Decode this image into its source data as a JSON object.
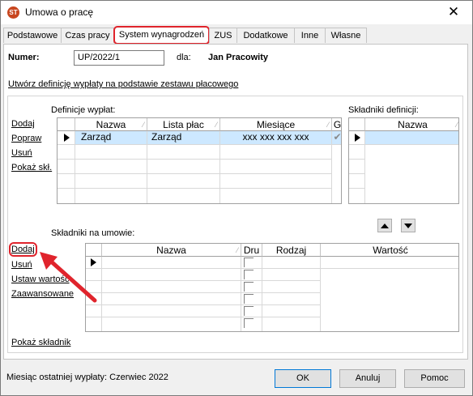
{
  "window": {
    "title": "Umowa o pracę",
    "close_glyph": "✕",
    "icon_text": "ST"
  },
  "tabs": [
    {
      "label": "Podstawowe"
    },
    {
      "label": "Czas pracy"
    },
    {
      "label": "System wynagrodzeń",
      "active": true
    },
    {
      "label": "ZUS"
    },
    {
      "label": "Dodatkowe"
    },
    {
      "label": "Inne"
    },
    {
      "label": "Własne"
    }
  ],
  "header": {
    "numer_label": "Numer:",
    "numer_value": "UP/2022/1",
    "dla_label": "dla:",
    "employee": "Jan Pracowity"
  },
  "create_link": "Utwórz definicję wypłaty na podstawie zestawu płacowego",
  "definitions": {
    "section_label": "Definicje wypłat:",
    "actions": [
      "Dodaj",
      "Popraw",
      "Usuń",
      "Pokaż skł."
    ],
    "columns": [
      "Nazwa",
      "Lista płac",
      "Miesiące",
      "G"
    ],
    "rows": [
      {
        "nazwa": "Zarząd",
        "lista": "Zarząd",
        "miesiace": "xxx xxx xxx xxx",
        "checked": true
      }
    ]
  },
  "components_def": {
    "section_label": "Składniki definicji:",
    "columns": [
      "Nazwa"
    ]
  },
  "contract_components": {
    "section_label": "Składniki na umowie:",
    "actions": [
      "Dodaj",
      "Usuń",
      "Ustaw wartość",
      "Zaawansowane"
    ],
    "columns": [
      "Nazwa",
      "Dru",
      "Rodzaj",
      "Wartość"
    ]
  },
  "show_component_link": "Pokaż składnik",
  "status": {
    "last_payout": "Miesiąc ostatniej wypłaty: Czerwiec 2022"
  },
  "buttons": {
    "ok": "OK",
    "cancel": "Anuluj",
    "help": "Pomoc"
  },
  "colors": {
    "highlight_red": "#e0242c",
    "selection": "#cde8ff"
  }
}
